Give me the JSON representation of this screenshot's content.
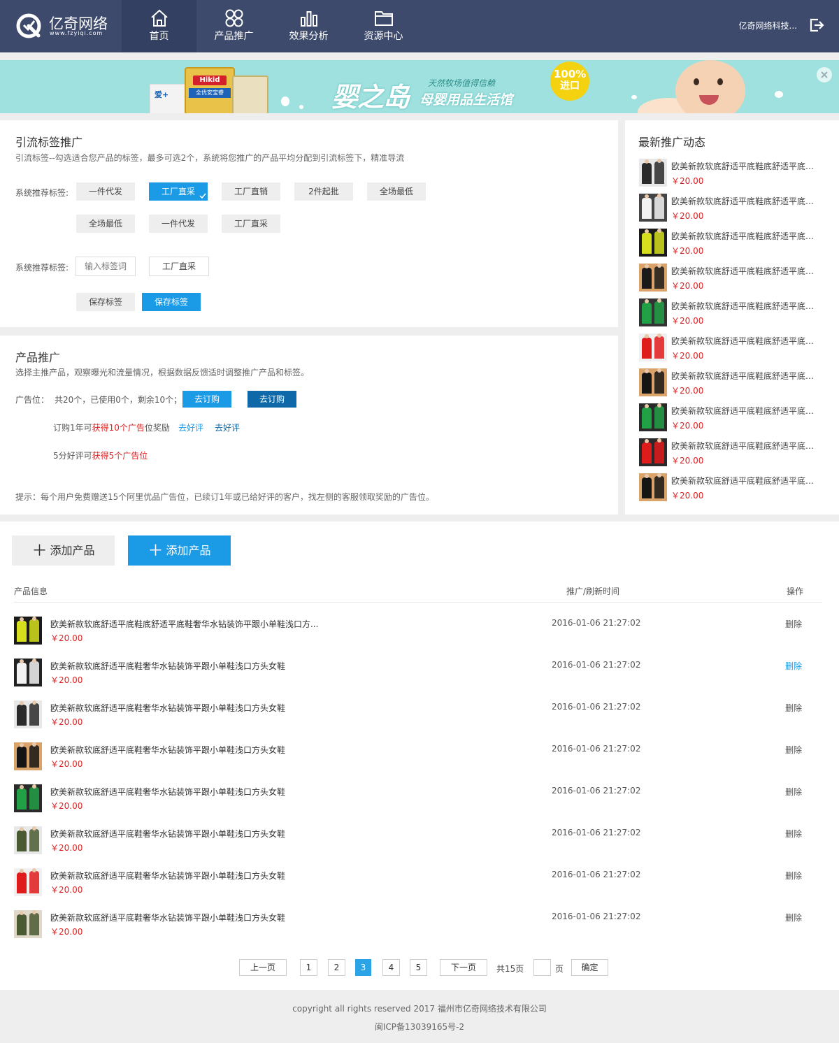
{
  "header": {
    "logo_cn": "亿奇网络",
    "logo_en": "www.fzyiqi.com",
    "nav": [
      {
        "label": "首页",
        "icon": "home-icon"
      },
      {
        "label": "产品推广",
        "icon": "clover-icon"
      },
      {
        "label": "效果分析",
        "icon": "bar-chart-icon"
      },
      {
        "label": "资源中心",
        "icon": "folder-icon"
      }
    ],
    "company": "亿奇网络科技...",
    "logout_icon": "logout-icon"
  },
  "banner": {
    "brand": "婴之岛",
    "subtitle": "母婴用品生活馆",
    "slogan": "天然牧场值得信赖",
    "badge_top": "100%",
    "badge_bottom": "进口",
    "can_top": "Hikid",
    "can_mid": "全优安宝睿",
    "can_left": "爱+",
    "close_icon": "close-icon"
  },
  "tags": {
    "title": "引流标签推广",
    "desc": "引流标签--勾选适合您产品的标签，最多可选2个，系统将您推广的产品平均分配到引流标签下，精准导流",
    "row_label": "系统推荐标签:",
    "row1": [
      "一件代发",
      "工厂直采",
      "工厂直销",
      "2件起批",
      "全场最低"
    ],
    "row2": [
      "全场最低",
      "一件代发",
      "工厂直采"
    ],
    "custom_label": "系统推荐标签:",
    "input_placeholder": "输入标签词",
    "custom_tag": "工厂直采",
    "save1": "保存标签",
    "save2": "保存标签"
  },
  "promo": {
    "title": "产品推广",
    "desc": "选择主推产品，观察曝光和流量情况，根据数据反馈适时调整推广产品和标签。",
    "ad_label": "广告位：",
    "ad_stats": "共20个，已使用0个，剩余10个；",
    "subscribe1": "去订购",
    "subscribe2": "去订购",
    "reward1_pre": "订购1年可",
    "reward1_red": "获得10个广告",
    "reward1_post": "位奖励",
    "review1": "去好评",
    "review2": "去好评",
    "reward2_pre": "5分好评可",
    "reward2_red": "获得5个广告位",
    "tip": "提示：每个用户免费赠送15个阿里优品广告位，已续订1年或已给好评的客户，找左侧的客服领取奖励的广告位。"
  },
  "feed": {
    "title": "最新推广动态",
    "items": [
      {
        "title": "欧美新款软底舒适平底鞋底舒适平底舒适平底鞋",
        "price": "￥20.00",
        "c1": "#2a2a2a",
        "c2": "#e8e8e8"
      },
      {
        "title": "欧美新款软底舒适平底鞋底舒适平底舒适平底鞋",
        "price": "￥20.00",
        "c1": "#f2f2f2",
        "c2": "#444444"
      },
      {
        "title": "欧美新款软底舒适平底鞋底舒适平底舒适平底鞋",
        "price": "￥20.00",
        "c1": "#d6df1e",
        "c2": "#1a1a1a"
      },
      {
        "title": "欧美新款软底舒适平底鞋底舒适平底舒适平底鞋",
        "price": "￥20.00",
        "c1": "#1a1a1a",
        "c2": "#d9a36a"
      },
      {
        "title": "欧美新款软底舒适平底鞋底舒适平底舒适平底鞋",
        "price": "￥20.00",
        "c1": "#22a045",
        "c2": "#333333"
      },
      {
        "title": "欧美新款软底舒适平底鞋底舒适平底舒适平底鞋",
        "price": "￥20.00",
        "c1": "#e01b1b",
        "c2": "#f0f0f0"
      },
      {
        "title": "欧美新款软底舒适平底鞋底舒适平底舒适平底鞋",
        "price": "￥20.00",
        "c1": "#151515",
        "c2": "#d9a36a"
      },
      {
        "title": "欧美新款软底舒适平底鞋底舒适平底舒适平底鞋",
        "price": "￥20.00",
        "c1": "#22a045",
        "c2": "#2a2a2a"
      },
      {
        "title": "欧美新款软底舒适平底鞋底舒适平底舒适平底鞋",
        "price": "￥20.00",
        "c1": "#e01b1b",
        "c2": "#2a2a2a"
      },
      {
        "title": "欧美新款软底舒适平底鞋底舒适平底舒适平底鞋",
        "price": "￥20.00",
        "c1": "#151515",
        "c2": "#d9a36a"
      }
    ]
  },
  "products": {
    "add_button1": "添加产品",
    "add_button2": "添加产品",
    "plus_icon": "plus-icon",
    "col_info": "产品信息",
    "col_time": "推广/刷新时间",
    "col_action": "操作",
    "rows": [
      {
        "title": "欧美新款软底舒适平底鞋底舒适平底鞋奢华水钻装饰平跟小单鞋浅口方...",
        "price": "￥20.00",
        "time": "2016-01-06 21:27:02",
        "action": "删除",
        "c1": "#d6df1e",
        "c2": "#1a1a1a"
      },
      {
        "title": "欧美新款软底舒适平底鞋奢华水钻装饰平跟小单鞋浅口方头女鞋",
        "price": "￥20.00",
        "time": "2016-01-06 21:27:02",
        "action": "删除",
        "c1": "#f2f2f2",
        "c2": "#222222"
      },
      {
        "title": "欧美新款软底舒适平底鞋奢华水钻装饰平跟小单鞋浅口方头女鞋",
        "price": "￥20.00",
        "time": "2016-01-06 21:27:02",
        "action": "删除",
        "c1": "#2a2a2a",
        "c2": "#e8e8e8"
      },
      {
        "title": "欧美新款软底舒适平底鞋奢华水钻装饰平跟小单鞋浅口方头女鞋",
        "price": "￥20.00",
        "time": "2016-01-06 21:27:02",
        "action": "删除",
        "c1": "#151515",
        "c2": "#d9a36a"
      },
      {
        "title": "欧美新款软底舒适平底鞋奢华水钻装饰平跟小单鞋浅口方头女鞋",
        "price": "￥20.00",
        "time": "2016-01-06 21:27:02",
        "action": "删除",
        "c1": "#22a045",
        "c2": "#2a2a2a"
      },
      {
        "title": "欧美新款软底舒适平底鞋奢华水钻装饰平跟小单鞋浅口方头女鞋",
        "price": "￥20.00",
        "time": "2016-01-06 21:27:02",
        "action": "删除",
        "c1": "#4a5a32",
        "c2": "#e8e8e8"
      },
      {
        "title": "欧美新款软底舒适平底鞋奢华水钻装饰平跟小单鞋浅口方头女鞋",
        "price": "￥20.00",
        "time": "2016-01-06 21:27:02",
        "action": "删除",
        "c1": "#e01b1b",
        "c2": "#f0f0f0"
      },
      {
        "title": "欧美新款软底舒适平底鞋奢华水钻装饰平跟小单鞋浅口方头女鞋",
        "price": "￥20.00",
        "time": "2016-01-06 21:27:02",
        "action": "删除",
        "c1": "#4a5a32",
        "c2": "#e0d8c8"
      }
    ]
  },
  "pagination": {
    "prev": "上一页",
    "pages": [
      "1",
      "2",
      "3",
      "4",
      "5"
    ],
    "current": "3",
    "next": "下一页",
    "total": "共15页",
    "page_unit": "页",
    "confirm": "确定"
  },
  "footer": {
    "copyright": "copyright all rights reserved 2017  福州市亿奇网络技术有限公司",
    "icp": "闽ICP备13039165号-2"
  },
  "colors": {
    "header_bg": "#3e4a6c",
    "accent": "#1b9ae6",
    "price": "#e02020"
  }
}
